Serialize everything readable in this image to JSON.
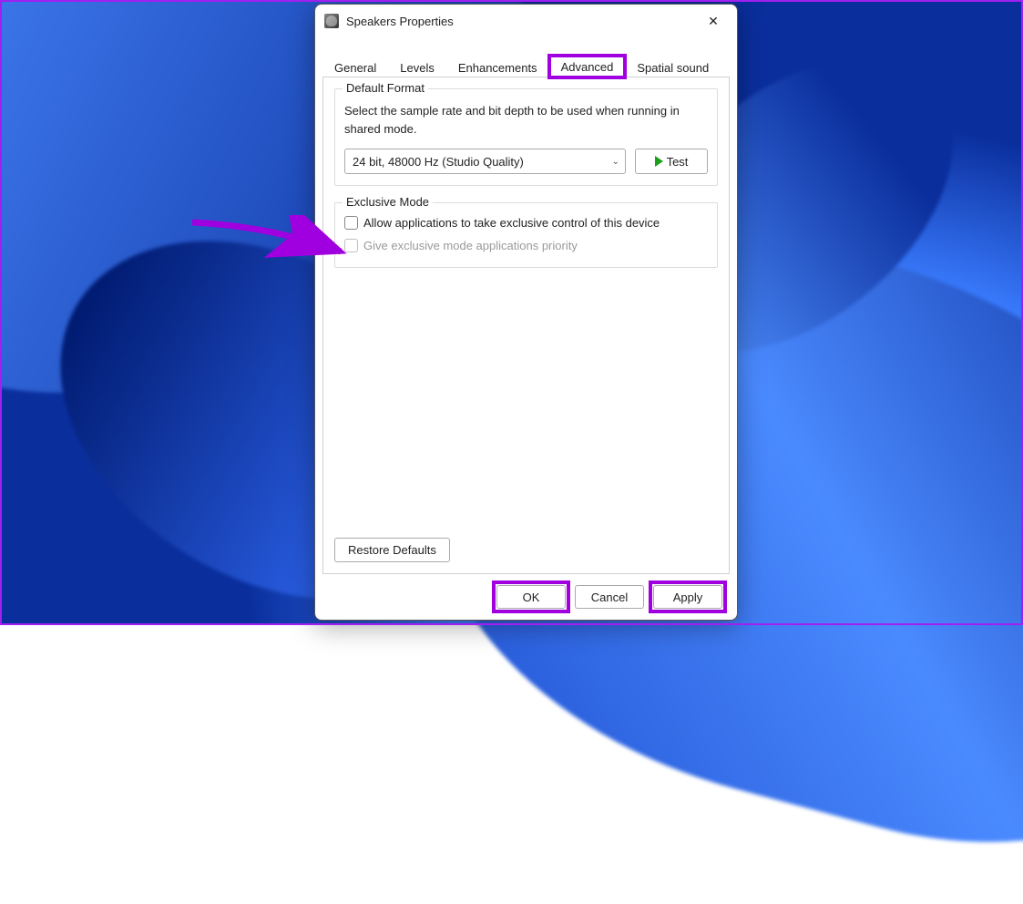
{
  "window": {
    "title": "Speakers Properties",
    "close_glyph": "✕"
  },
  "tabs": {
    "items": [
      "General",
      "Levels",
      "Enhancements",
      "Advanced",
      "Spatial sound"
    ],
    "active_index": 3
  },
  "default_format": {
    "legend": "Default Format",
    "description": "Select the sample rate and bit depth to be used when running in shared mode.",
    "selected": "24 bit, 48000 Hz (Studio Quality)",
    "test_label": "Test"
  },
  "exclusive_mode": {
    "legend": "Exclusive Mode",
    "allow_label": "Allow applications to take exclusive control of this device",
    "allow_checked": false,
    "priority_label": "Give exclusive mode applications priority",
    "priority_enabled": false,
    "priority_checked": false
  },
  "restore_label": "Restore Defaults",
  "footer": {
    "ok": "OK",
    "cancel": "Cancel",
    "apply": "Apply"
  },
  "annotation": {
    "highlight_color": "#a000e0"
  }
}
